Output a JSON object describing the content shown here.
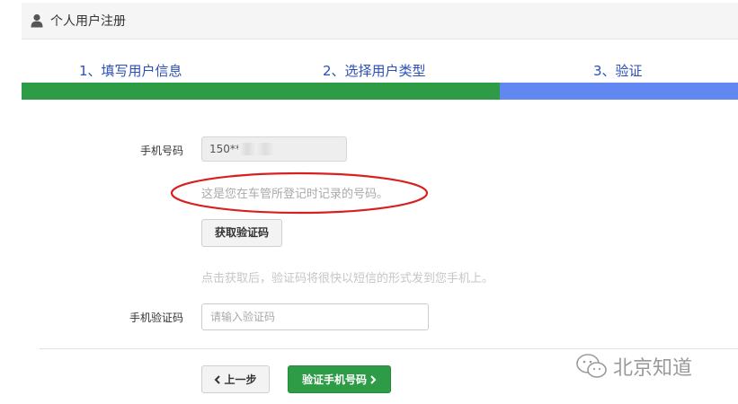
{
  "header": {
    "title": "个人用户注册",
    "icon": "user-icon"
  },
  "steps": [
    {
      "label": "1、填写用户信息"
    },
    {
      "label": "2、选择用户类型"
    },
    {
      "label": "3、验证"
    }
  ],
  "progress": {
    "completed_fraction": 0.667,
    "done_color": "#2e9c47",
    "todo_color": "#6188f1"
  },
  "form": {
    "phone_label": "手机号码",
    "phone_value": "150**",
    "phone_hint": "这是您在车管所登记时记录的号码。",
    "get_code_button": "获取验证码",
    "send_hint": "点击获取后，验证码将很快以短信的形式发到您手机上。",
    "code_label": "手机验证码",
    "code_placeholder": "请输入验证码",
    "code_value": ""
  },
  "actions": {
    "prev_button": "上一步",
    "verify_button": "验证手机号码"
  },
  "watermark": {
    "text": "北京知道",
    "icon": "wechat-icon"
  },
  "annotation_color": "#d92020"
}
